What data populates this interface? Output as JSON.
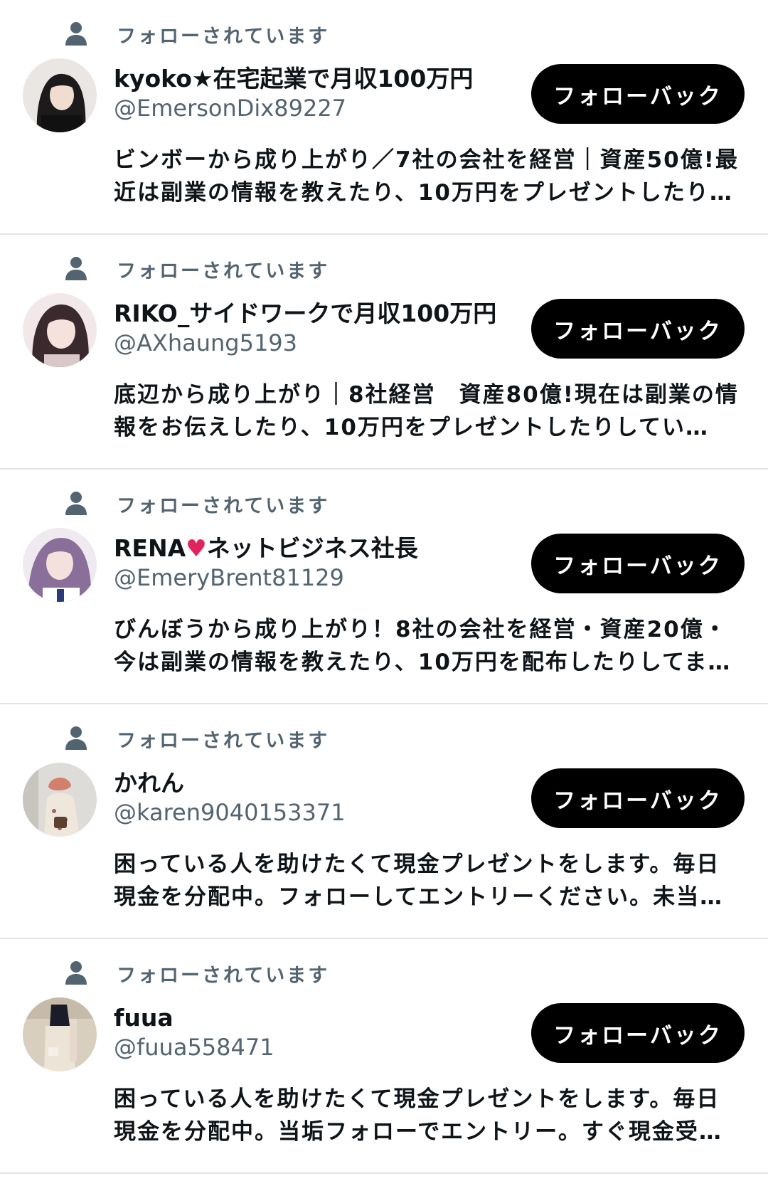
{
  "followers": [
    {
      "follows_you": "フォローされています",
      "display_name": "kyoko★在宅起業で月収100万円",
      "handle": "@EmersonDix89227",
      "button_label": "フォローバック",
      "bio": "ビンボーから成り上がり／7社の会社を経営｜資産50億!最近は副業の情報を教えたり、10万円をプレゼントしたり…"
    },
    {
      "follows_you": "フォローされています",
      "display_name": "RIKO_サイドワークで月収100万円",
      "handle": "@AXhaung5193",
      "button_label": "フォローバック",
      "bio": "底辺から成り上がり｜8社経営　資産80億!現在は副業の情報をお伝えしたり、10万円をプレゼントしたりしてい…"
    },
    {
      "follows_you": "フォローされています",
      "display_name": "RENA♥ネットビジネス社長",
      "handle": "@EmeryBrent81129",
      "button_label": "フォローバック",
      "bio": "びんぼうから成り上がり！8社の会社を経営・資産20億・今は副業の情報を教えたり、10万円を配布したりしてます…"
    },
    {
      "follows_you": "フォローされています",
      "display_name": "かれん",
      "handle": "@karen9040153371",
      "button_label": "フォローバック",
      "bio": "困っている人を助けたくて現金プレゼントをします。毎日現金を分配中。フォローしてエントリーください。未当…"
    },
    {
      "follows_you": "フォローされています",
      "display_name": "fuua",
      "handle": "@fuua558471",
      "button_label": "フォローバック",
      "bio": "困っている人を助けたくて現金プレゼントをします。毎日現金を分配中。当垢フォローでエントリー。すぐ現金受…"
    }
  ],
  "icons": {
    "follows_indicator": "person-icon",
    "avatar": "avatar-photo"
  },
  "colors": {
    "button_background": "#000000",
    "button_text": "#ffffff",
    "secondary_text": "#536471",
    "primary_text": "#0f1419",
    "divider": "#e1e4e7",
    "heart": "#e0245e"
  }
}
